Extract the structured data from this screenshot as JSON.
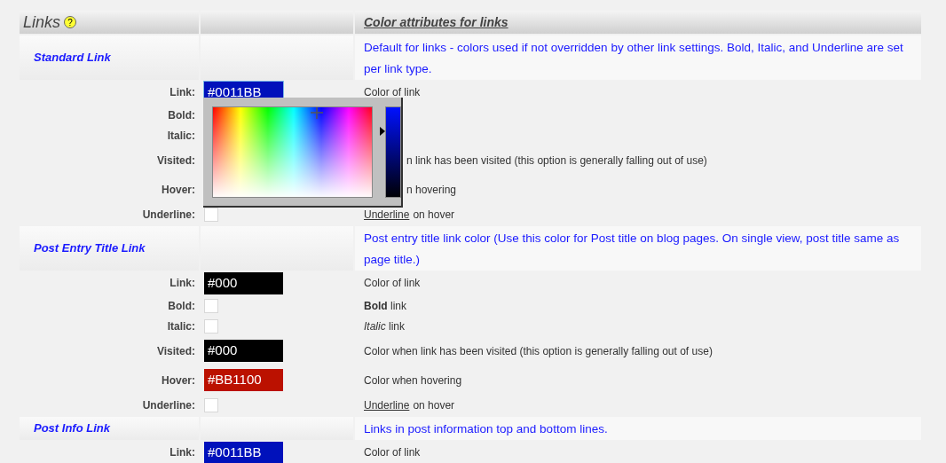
{
  "header": {
    "title": "Links",
    "help_icon": "?",
    "description_heading": "Color attributes for links"
  },
  "sections": [
    {
      "title": "Standard Link",
      "description": "Default for links - colors used if not overridden by other link settings. Bold, Italic, and Underline are set per link type.",
      "rows": [
        {
          "kind": "color",
          "label": "Link:",
          "value": "#0011BB",
          "color": "#0011bb",
          "focused": true,
          "description": "Color of link"
        },
        {
          "kind": "covered",
          "label": "Bold:"
        },
        {
          "kind": "covered",
          "label": "Italic:"
        },
        {
          "kind": "covered",
          "label": "Visited:",
          "description": "n link has been visited (this option is generally falling out of use)"
        },
        {
          "kind": "covered",
          "label": "Hover:",
          "description": "n hovering"
        },
        {
          "kind": "checkbox",
          "label": "Underline:",
          "checked": false,
          "description_link": "Underline",
          "description": "on hover"
        }
      ]
    },
    {
      "title": "Post Entry Title Link",
      "description": "Post entry title link color (Use this color for Post title on blog pages. On single view, post title same as page title.)",
      "rows": [
        {
          "kind": "color",
          "label": "Link:",
          "value": "#000",
          "color": "#000000",
          "focused": false,
          "description": "Color of link"
        },
        {
          "kind": "checkbox",
          "label": "Bold:",
          "checked": false,
          "description": "**Bold** link"
        },
        {
          "kind": "checkbox",
          "label": "Italic:",
          "checked": false,
          "description": "*Italic* link"
        },
        {
          "kind": "color",
          "label": "Visited:",
          "value": "#000",
          "color": "#000000",
          "focused": false,
          "description": "Color when link has been visited (this option is generally falling out of use)"
        },
        {
          "kind": "color",
          "label": "Hover:",
          "value": "#BB1100",
          "color": "#bb1100",
          "focused": false,
          "description": "Color when hovering"
        },
        {
          "kind": "checkbox",
          "label": "Underline:",
          "checked": false,
          "description_link": "Underline",
          "description": "on hover"
        }
      ]
    },
    {
      "title": "Post Info Link",
      "description": "Links in post information top and bottom lines.",
      "rows": [
        {
          "kind": "color",
          "label": "Link:",
          "value": "#0011BB",
          "color": "#0011bb",
          "focused": false,
          "description": "Color of link"
        }
      ]
    }
  ],
  "color_picker": {
    "open": true
  }
}
